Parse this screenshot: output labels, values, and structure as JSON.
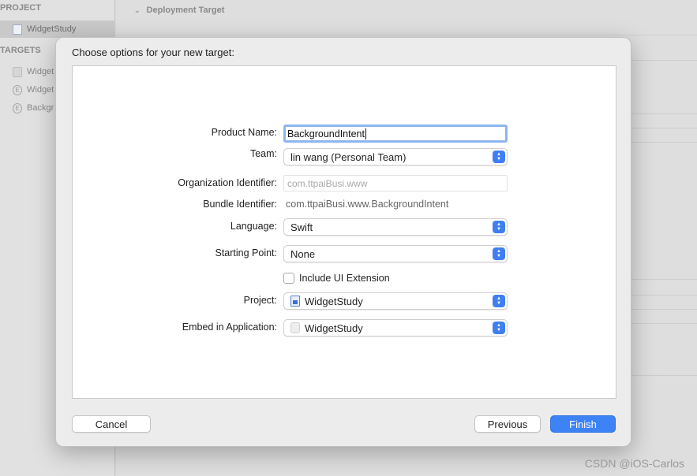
{
  "background": {
    "sidebar": {
      "project_section": "PROJECT",
      "project_item": "WidgetStudy",
      "targets_section": "TARGETS",
      "target_items": [
        "Widget",
        "Widget",
        "Backgr"
      ]
    },
    "main": {
      "disclosure_title": "Deployment Target"
    }
  },
  "dialog": {
    "title": "Choose options for your new target:",
    "form": {
      "product_name": {
        "label": "Product Name:",
        "value": "BackgroundIntent"
      },
      "team": {
        "label": "Team:",
        "value": "lin wang (Personal Team)"
      },
      "organization_identifier": {
        "label": "Organization Identifier:",
        "value": "com.ttpaiBusi.www"
      },
      "bundle_identifier": {
        "label": "Bundle Identifier:",
        "value": "com.ttpaiBusi.www.BackgroundIntent"
      },
      "language": {
        "label": "Language:",
        "value": "Swift"
      },
      "starting_point": {
        "label": "Starting Point:",
        "value": "None"
      },
      "include_ui_extension": {
        "label": "Include UI Extension",
        "checked": false
      },
      "project": {
        "label": "Project:",
        "value": "WidgetStudy"
      },
      "embed_in_application": {
        "label": "Embed in Application:",
        "value": "WidgetStudy"
      }
    },
    "buttons": {
      "cancel": "Cancel",
      "previous": "Previous",
      "finish": "Finish"
    }
  },
  "watermark": "CSDN @iOS-Carlos",
  "colors": {
    "accent": "#3d83f6",
    "focus_ring": "#8db5f0"
  }
}
